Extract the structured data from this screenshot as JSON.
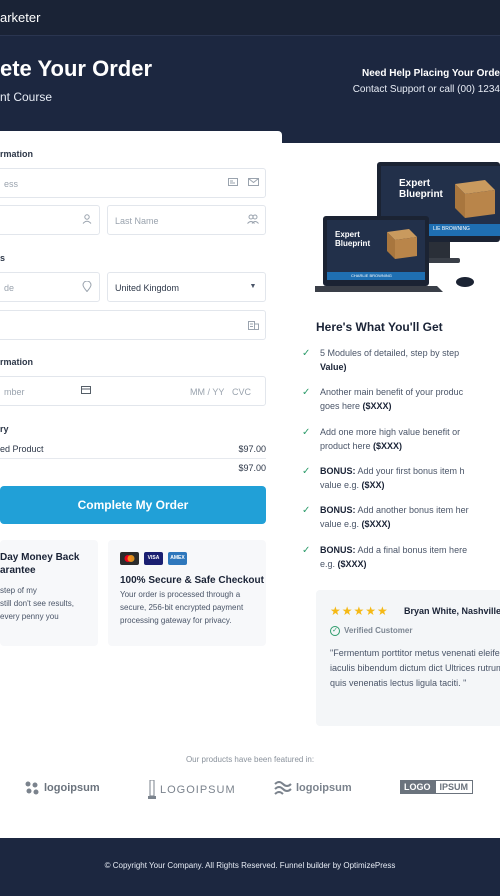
{
  "header": {
    "brand": "arketer"
  },
  "hero": {
    "title": "ete Your Order",
    "subtitle": "nt Course",
    "help_title": "Need Help Placing Your Orde",
    "help_sub": "Contact Support or call (00) 1234"
  },
  "form": {
    "contact_label": "rmation",
    "email_placeholder": "ess",
    "first_name_placeholder": "",
    "last_name_placeholder": "Last Name",
    "address_label": "s",
    "zip_placeholder": "de",
    "country_value": "United Kingdom",
    "state_placeholder": "",
    "payment_label": "rmation",
    "card_placeholder": "mber",
    "expiry_placeholder": "MM / YY",
    "cvc_placeholder": "CVC",
    "summary_label": "ry",
    "product_name": "ed Product",
    "product_price": "$97.00",
    "total_price": "$97.00",
    "cta_label": "Complete My Order"
  },
  "trust": {
    "guarantee_title_1": "Day Money Back",
    "guarantee_title_2": "arantee",
    "guarantee_text_1": "step of my",
    "guarantee_text_2": "still don't see results,",
    "guarantee_text_3": "every penny you",
    "secure_title": "100% Secure & Safe Checkout",
    "secure_text_1": "Your order is processed through a",
    "secure_text_2": "secure, 256-bit encrypted payment",
    "secure_text_3": "processing gateway for privacy.",
    "card_brands": [
      "mastercard",
      "VISA",
      "AMEX"
    ]
  },
  "product": {
    "image_title_1": "Expert",
    "image_title_2": "Blueprint",
    "image_author": "LIE BROWNING",
    "image_author_laptop": "CHARLIE BROWNING"
  },
  "benefits": {
    "heading": "Here's What You'll Get",
    "items": [
      {
        "line1": "5 Modules of detailed, step by step",
        "line2_bold": "Value)"
      },
      {
        "line1": "Another main benefit of your produc",
        "line2": "goes here ",
        "line2_bold": "($XXX)"
      },
      {
        "line1": "Add one more high value benefit or",
        "line2": "product here ",
        "line2_bold": "($XXX)"
      },
      {
        "bold1": "BONUS:",
        "line1": " Add your first bonus item h",
        "line2": "value e.g. ",
        "line2_bold": "($XX)"
      },
      {
        "bold1": "BONUS:",
        "line1": " Add another bonus item her",
        "line2": "value e.g. ",
        "line2_bold": "($XXX)"
      },
      {
        "bold1": "BONUS:",
        "line1": " Add a final bonus item here",
        "line2": "e.g. ",
        "line2_bold": "($XXX)"
      }
    ]
  },
  "review": {
    "stars": "★★★★★",
    "name": "Bryan White, Nashville",
    "verified": "Verified Customer",
    "quote": "\"Fermentum porttitor metus venenati eleifend iaculis bibendum dictum dict Ultrices rutrum quis venenatis lectus ligula taciti. \""
  },
  "featured": {
    "label": "Our products have been featured in:",
    "logos": [
      "logoipsum",
      "LOGOIPSUM",
      "logoipsum",
      "LOGO",
      "IPSUM"
    ]
  },
  "footer": {
    "text": "© Copyright Your Company.  All Rights Reserved. Funnel builder by OptimizePress"
  },
  "colors": {
    "accent": "#21a0d7",
    "navy": "#1c2740",
    "check": "#2f9c6c",
    "star": "#f5b916"
  }
}
